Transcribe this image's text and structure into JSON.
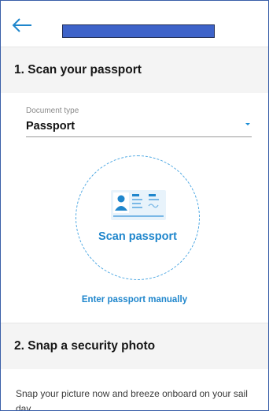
{
  "header": {
    "back_icon": "arrow-left-icon",
    "title_redaction_color": "#3e63c9"
  },
  "section1": {
    "title": "1. Scan your passport",
    "document_type_label": "Document type",
    "document_type_value": "Passport",
    "dropdown_icon": "caret-down-icon",
    "scan_icon": "passport-id-card-icon",
    "scan_label": "Scan passport",
    "manual_link": "Enter passport manually"
  },
  "section2": {
    "title": "2. Snap a security photo",
    "description": "Snap your picture now and breeze onboard on your sail day."
  },
  "colors": {
    "accent": "#1f86cc",
    "section_bg": "#f4f4f4",
    "dashed_circle": "#4aa6e2"
  }
}
